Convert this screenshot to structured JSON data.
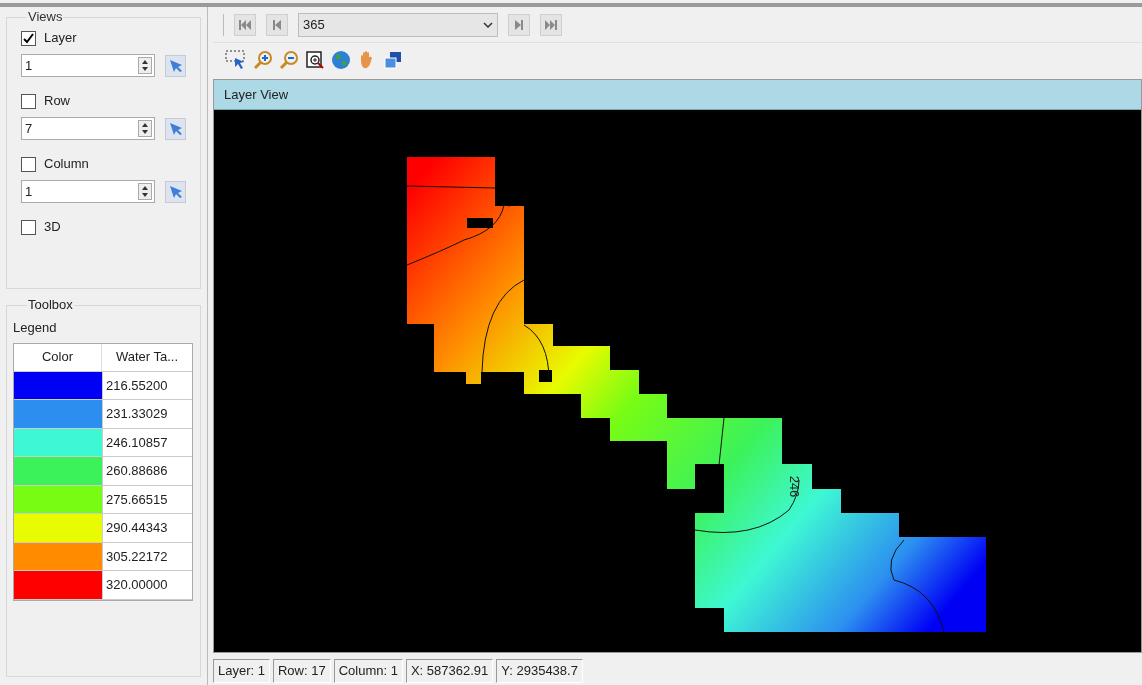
{
  "views": {
    "title": "Views",
    "options": [
      {
        "label": "Layer",
        "checked": true,
        "value": "1"
      },
      {
        "label": "Row",
        "checked": false,
        "value": "7"
      },
      {
        "label": "Column",
        "checked": false,
        "value": "1"
      },
      {
        "label": "3D",
        "checked": false
      }
    ]
  },
  "toolbox": {
    "title": "Toolbox",
    "legend_title": "Legend",
    "columns": [
      "Color",
      "Water Ta..."
    ],
    "rows": [
      {
        "color": "#0000f5",
        "value": "216.55200"
      },
      {
        "color": "#2c8ff0",
        "value": "231.33029"
      },
      {
        "color": "#3ef8d4",
        "value": "246.10857"
      },
      {
        "color": "#3cf25a",
        "value": "260.88686"
      },
      {
        "color": "#78fc14",
        "value": "275.66515"
      },
      {
        "color": "#e8fb00",
        "value": "290.44343"
      },
      {
        "color": "#ff8c00",
        "value": "305.22172"
      },
      {
        "color": "#ff0000",
        "value": "320.00000"
      }
    ]
  },
  "time_toolbar": {
    "step": "365"
  },
  "layer_view": {
    "title": "Layer View",
    "contour_labels": [
      "246"
    ]
  },
  "status_bar": [
    "Layer: 1",
    "Row: 17",
    "Column: 1",
    "X: 587362.91",
    "Y: 2935438.7"
  ]
}
